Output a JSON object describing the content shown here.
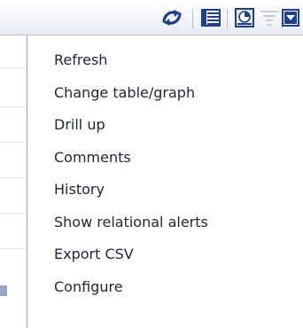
{
  "toolbar": {
    "buttons": [
      {
        "icon": "refresh-icon"
      },
      {
        "icon": "table-icon"
      },
      {
        "icon": "chart-icon"
      },
      {
        "icon": "filter-icon"
      },
      {
        "icon": "dropdown-icon"
      }
    ]
  },
  "menu": {
    "items": [
      {
        "label": "Refresh"
      },
      {
        "label": "Change table/graph"
      },
      {
        "label": "Drill up"
      },
      {
        "label": "Comments"
      },
      {
        "label": "History"
      },
      {
        "label": "Show relational alerts"
      },
      {
        "label": "Export CSV"
      },
      {
        "label": "Configure"
      }
    ]
  },
  "colors": {
    "icon_blue": "#1f3f87",
    "menu_text": "#1f2733",
    "menu_border": "#9aa6b8",
    "toolbar_border": "#b9c3d2"
  }
}
